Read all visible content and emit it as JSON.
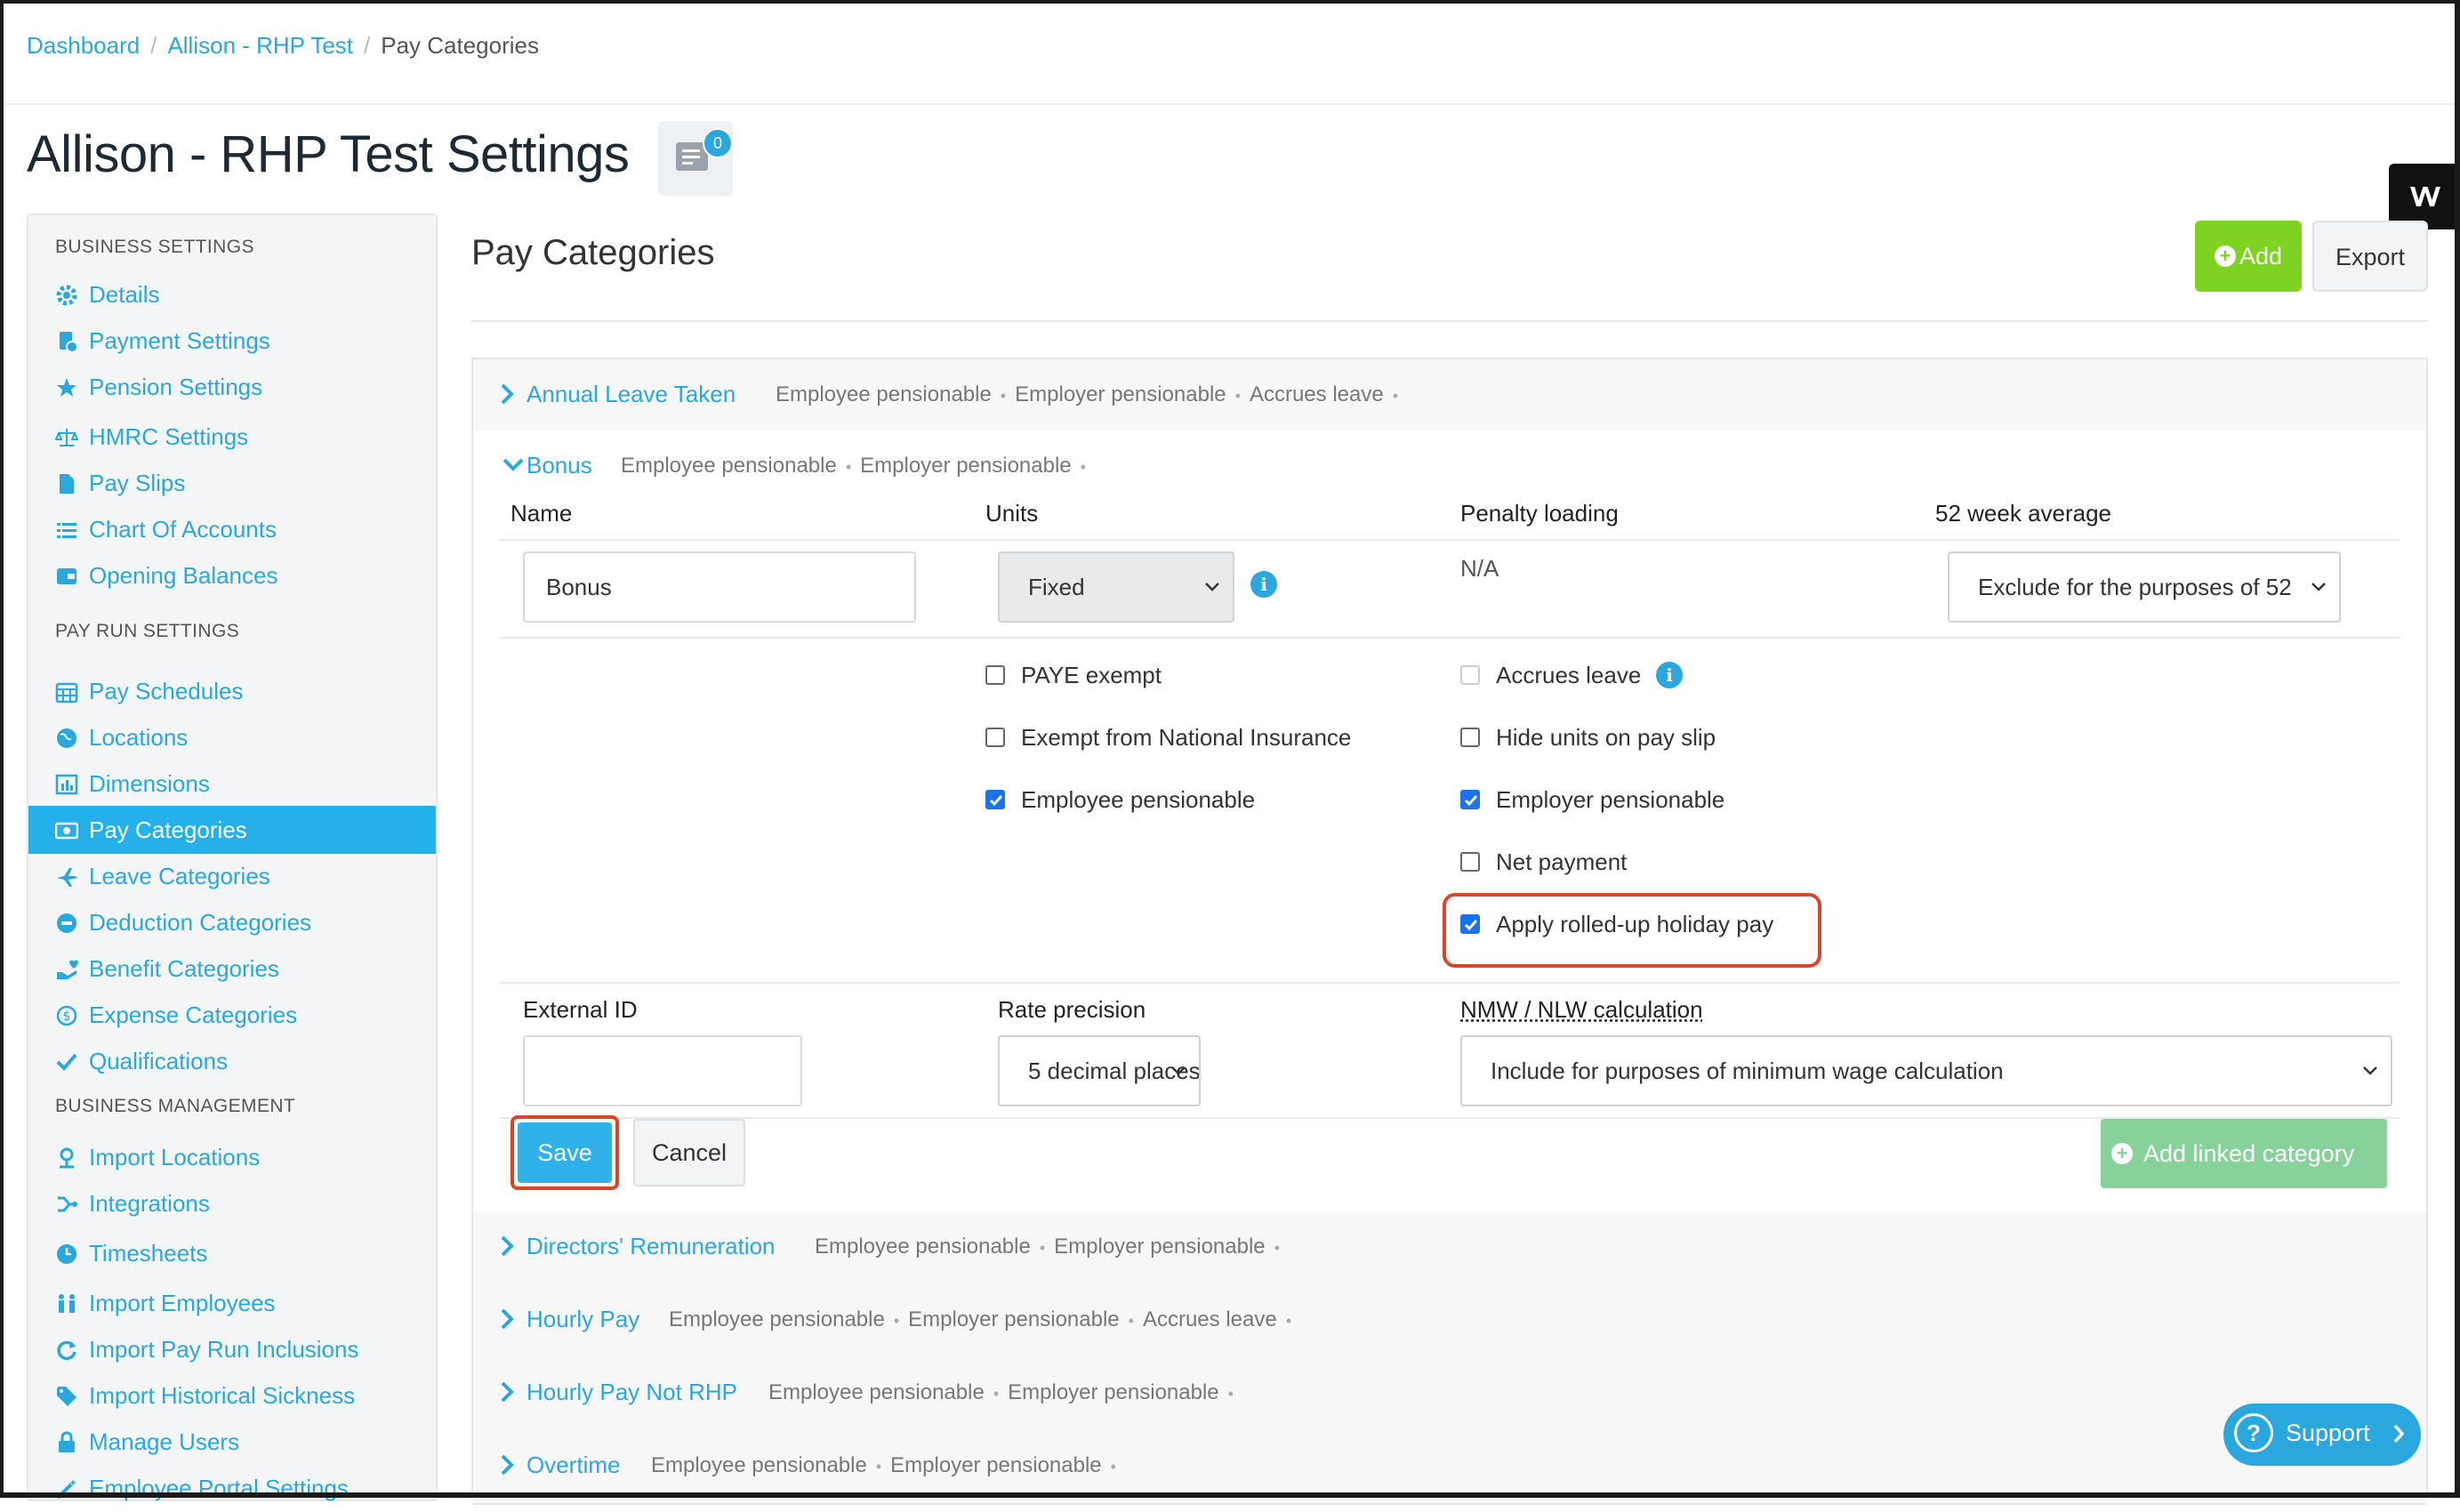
{
  "breadcrumb": {
    "items": [
      "Dashboard",
      "Allison - RHP Test"
    ],
    "current": "Pay Categories"
  },
  "page": {
    "title": "Allison - RHP Test Settings",
    "notes_count": "0"
  },
  "sidebar": {
    "sections": [
      {
        "heading": "BUSINESS SETTINGS"
      },
      {
        "heading": "PAY RUN SETTINGS"
      },
      {
        "heading": "BUSINESS MANAGEMENT"
      }
    ],
    "items": [
      {
        "label": "Details",
        "icon": "gear-icon"
      },
      {
        "label": "Payment Settings",
        "icon": "payment-doc-icon"
      },
      {
        "label": "Pension Settings",
        "icon": "star-icon"
      },
      {
        "label": "HMRC Settings",
        "icon": "scales-icon"
      },
      {
        "label": "Pay Slips",
        "icon": "file-icon"
      },
      {
        "label": "Chart Of Accounts",
        "icon": "list-icon"
      },
      {
        "label": "Opening Balances",
        "icon": "wallet-icon"
      },
      {
        "label": "Pay Schedules",
        "icon": "calendar-icon"
      },
      {
        "label": "Locations",
        "icon": "globe-icon"
      },
      {
        "label": "Dimensions",
        "icon": "bar-chart-icon"
      },
      {
        "label": "Pay Categories",
        "icon": "money-icon",
        "active": true
      },
      {
        "label": "Leave Categories",
        "icon": "plane-icon"
      },
      {
        "label": "Deduction Categories",
        "icon": "minus-circle-icon"
      },
      {
        "label": "Benefit Categories",
        "icon": "hand-heart-icon"
      },
      {
        "label": "Expense Categories",
        "icon": "dollar-circle-icon"
      },
      {
        "label": "Qualifications",
        "icon": "check-icon"
      },
      {
        "label": "Import Locations",
        "icon": "map-pin-icon"
      },
      {
        "label": "Integrations",
        "icon": "integration-icon"
      },
      {
        "label": "Timesheets",
        "icon": "clock-icon"
      },
      {
        "label": "Import Employees",
        "icon": "people-icon"
      },
      {
        "label": "Import Pay Run Inclusions",
        "icon": "refresh-icon"
      },
      {
        "label": "Import Historical Sickness",
        "icon": "tag-icon"
      },
      {
        "label": "Manage Users",
        "icon": "lock-icon"
      },
      {
        "label": "Employee Portal Settings",
        "icon": "wand-icon"
      }
    ]
  },
  "main": {
    "title": "Pay Categories",
    "add_label": "Add",
    "export_label": "Export"
  },
  "categories": [
    {
      "name": "Annual Leave Taken",
      "tags": [
        "Employee pensionable",
        "Employer pensionable",
        "Accrues leave"
      ]
    },
    {
      "name": "Bonus",
      "tags": [
        "Employee pensionable",
        "Employer pensionable"
      ],
      "expanded": true
    },
    {
      "name": "Directors' Remuneration",
      "tags": [
        "Employee pensionable",
        "Employer pensionable"
      ]
    },
    {
      "name": "Hourly Pay",
      "tags": [
        "Employee pensionable",
        "Employer pensionable",
        "Accrues leave"
      ]
    },
    {
      "name": "Hourly Pay Not RHP",
      "tags": [
        "Employee pensionable",
        "Employer pensionable"
      ]
    },
    {
      "name": "Overtime",
      "tags": [
        "Employee pensionable",
        "Employer pensionable"
      ]
    }
  ],
  "form": {
    "headers": {
      "name": "Name",
      "units": "Units",
      "penalty": "Penalty loading",
      "avg52": "52 week average"
    },
    "name_value": "Bonus",
    "units_value": "Fixed",
    "penalty_value": "N/A",
    "avg52_value": "Exclude for the purposes of 52",
    "checkboxes": {
      "paye_exempt": {
        "label": "PAYE exempt",
        "checked": false
      },
      "exempt_ni": {
        "label": "Exempt from National Insurance",
        "checked": false
      },
      "employee_pensionable": {
        "label": "Employee pensionable",
        "checked": true
      },
      "accrues_leave": {
        "label": "Accrues leave",
        "checked": false
      },
      "hide_units": {
        "label": "Hide units on pay slip",
        "checked": false
      },
      "employer_pensionable": {
        "label": "Employer pensionable",
        "checked": true
      },
      "net_payment": {
        "label": "Net payment",
        "checked": false
      },
      "rolled_up": {
        "label": "Apply rolled-up holiday pay",
        "checked": true
      }
    },
    "external_id_label": "External ID",
    "external_id_value": "",
    "rate_precision_label": "Rate precision",
    "rate_precision_value": "5 decimal places",
    "nmw_label": "NMW / NLW calculation",
    "nmw_value": "Include for purposes of minimum wage calculation",
    "save_label": "Save",
    "cancel_label": "Cancel",
    "add_linked_label": "Add linked category"
  },
  "support_label": "Support",
  "colors": {
    "accent": "#2aa7dd",
    "add_green": "#7ed321",
    "highlight": "#d9452c",
    "active_nav": "#24b0e8"
  }
}
